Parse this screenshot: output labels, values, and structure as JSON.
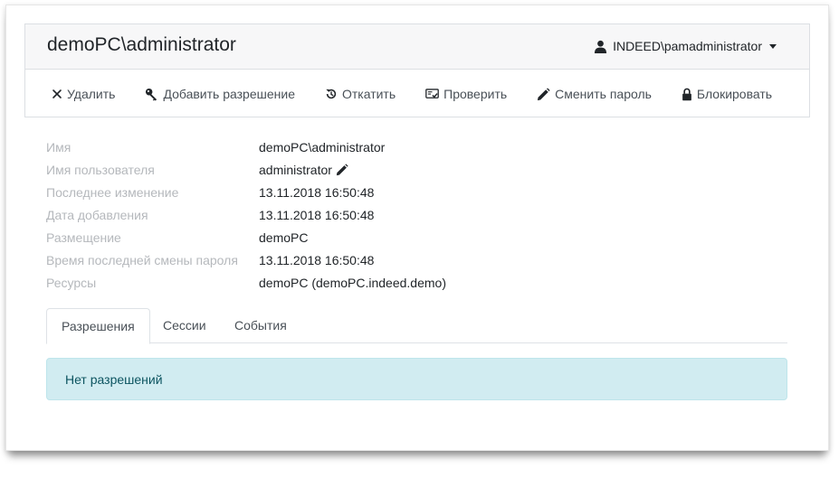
{
  "header": {
    "title": "demoPC\\administrator",
    "user": "INDEED\\pamadministrator"
  },
  "toolbar": {
    "delete": "Удалить",
    "add_permission": "Добавить разрешение",
    "rollback": "Откатить",
    "check": "Проверить",
    "change_password": "Сменить пароль",
    "block": "Блокировать"
  },
  "details": [
    {
      "label": "Имя",
      "value": "demoPC\\administrator"
    },
    {
      "label": "Имя пользователя",
      "value": "administrator"
    },
    {
      "label": "Последнее изменение",
      "value": "13.11.2018 16:50:48"
    },
    {
      "label": "Дата добавления",
      "value": "13.11.2018 16:50:48"
    },
    {
      "label": "Размещение",
      "value": "demoPC"
    },
    {
      "label": "Время последней смены пароля",
      "value": "13.11.2018 16:50:48"
    },
    {
      "label": "Ресурсы",
      "value": "demoPC (demoPC.indeed.demo)"
    }
  ],
  "tabs": [
    {
      "label": "Разрешения",
      "active": true
    },
    {
      "label": "Сессии",
      "active": false
    },
    {
      "label": "События",
      "active": false
    }
  ],
  "alert": {
    "text": "Нет разрешений"
  },
  "icons": {
    "user": "user-icon",
    "delete": "close-icon",
    "add_permission": "key-icon",
    "rollback": "history-icon",
    "check": "check-card-icon",
    "change_password": "pencil-icon",
    "block": "lock-icon",
    "edit_username": "pencil-icon"
  }
}
